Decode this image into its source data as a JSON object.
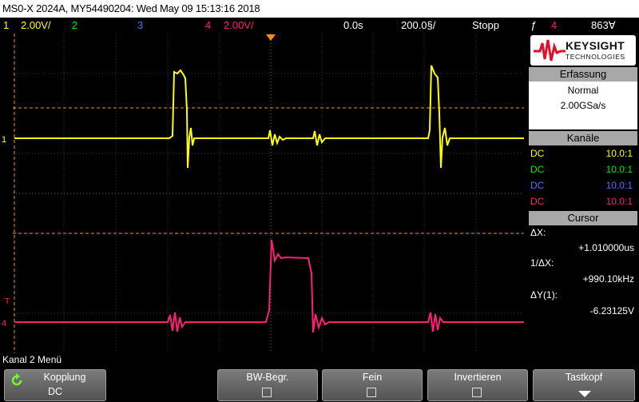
{
  "title": "MS0-X 2024A, MY54490204: Wed May 09 15:13:16 2018",
  "status": {
    "ch1_num": "1",
    "ch1_scale": "2.00V/",
    "ch2_num": "2",
    "ch3_num": "3",
    "ch4_num": "4",
    "ch4_scale": "2.00V/",
    "delay": "0.0s",
    "timebase": "200.0§/",
    "run_state": "Stopp",
    "trigger_symbol": "ƒ",
    "trigger_source": "4",
    "trigger_level": "863∀"
  },
  "colors": {
    "ch1": "#ffff00",
    "ch2": "#00ee00",
    "ch3": "#5a6cff",
    "ch4": "#ff1f7a",
    "trigger": "#ff8c1a"
  },
  "panel": {
    "logo_name": "KEYSIGHT",
    "logo_sub": "TECHNOLOGIES",
    "acq_header": "Erfassung",
    "acq_mode": "Normal",
    "acq_rate": "2.00GSa/s",
    "channels_header": "Kanäle",
    "channels": [
      {
        "coupling": "DC",
        "probe": "10.0:1"
      },
      {
        "coupling": "DC",
        "probe": "10.0:1"
      },
      {
        "coupling": "DC",
        "probe": "10.0:1"
      },
      {
        "coupling": "DC",
        "probe": "10.0:1"
      }
    ],
    "cursor_header": "Cursor",
    "dx_label": "ΔX:",
    "dx_value": "+1.010000us",
    "inv_dx_label": "1/ΔX:",
    "inv_dx_value": "+990.10kHz",
    "dy_label": "ΔY(1):",
    "dy_value": "-6.23125V"
  },
  "screen_markers": {
    "ch1": "1",
    "ch4": "4",
    "trigger": "T"
  },
  "menu": {
    "title": "Kanal 2 Menü",
    "coupling_label": "Kopplung",
    "coupling_value": "DC",
    "bw_label": "BW-Begr.",
    "fine_label": "Fein",
    "invert_label": "Invertieren",
    "probe_label": "Tastkopf"
  }
}
